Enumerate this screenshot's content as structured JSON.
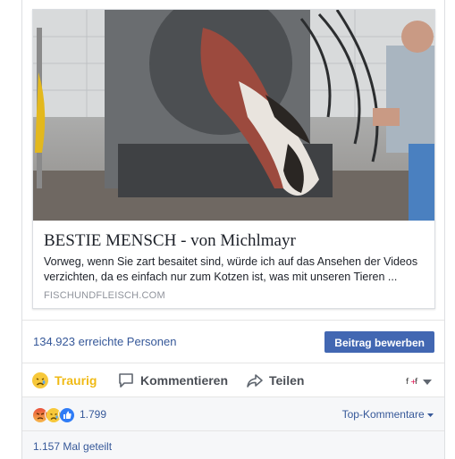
{
  "link_preview": {
    "title": "BESTIE MENSCH - von Michlmayr",
    "description": "Vorweg, wenn Sie zart besaitet sind, würde ich auf das Ansehen der Videos verzichten, da es einfach nur zum Kotzen ist, was mit unseren Tieren ...",
    "domain": "FISCHUNDFLEISCH.COM"
  },
  "reach": {
    "text": "134.923 erreichte Personen",
    "boost_label": "Beitrag bewerben"
  },
  "actions": {
    "reaction_label": "Traurig",
    "comment_label": "Kommentieren",
    "share_label": "Teilen"
  },
  "reactions": {
    "icons": [
      "angry-icon",
      "sad-icon",
      "like-icon"
    ],
    "count": "1.799",
    "sort_label": "Top-Kommentare"
  },
  "shares": {
    "text": "1.157 Mal geteilt"
  },
  "colors": {
    "link": "#365899",
    "boost": "#4267b2",
    "sad": "#f0ba15"
  }
}
